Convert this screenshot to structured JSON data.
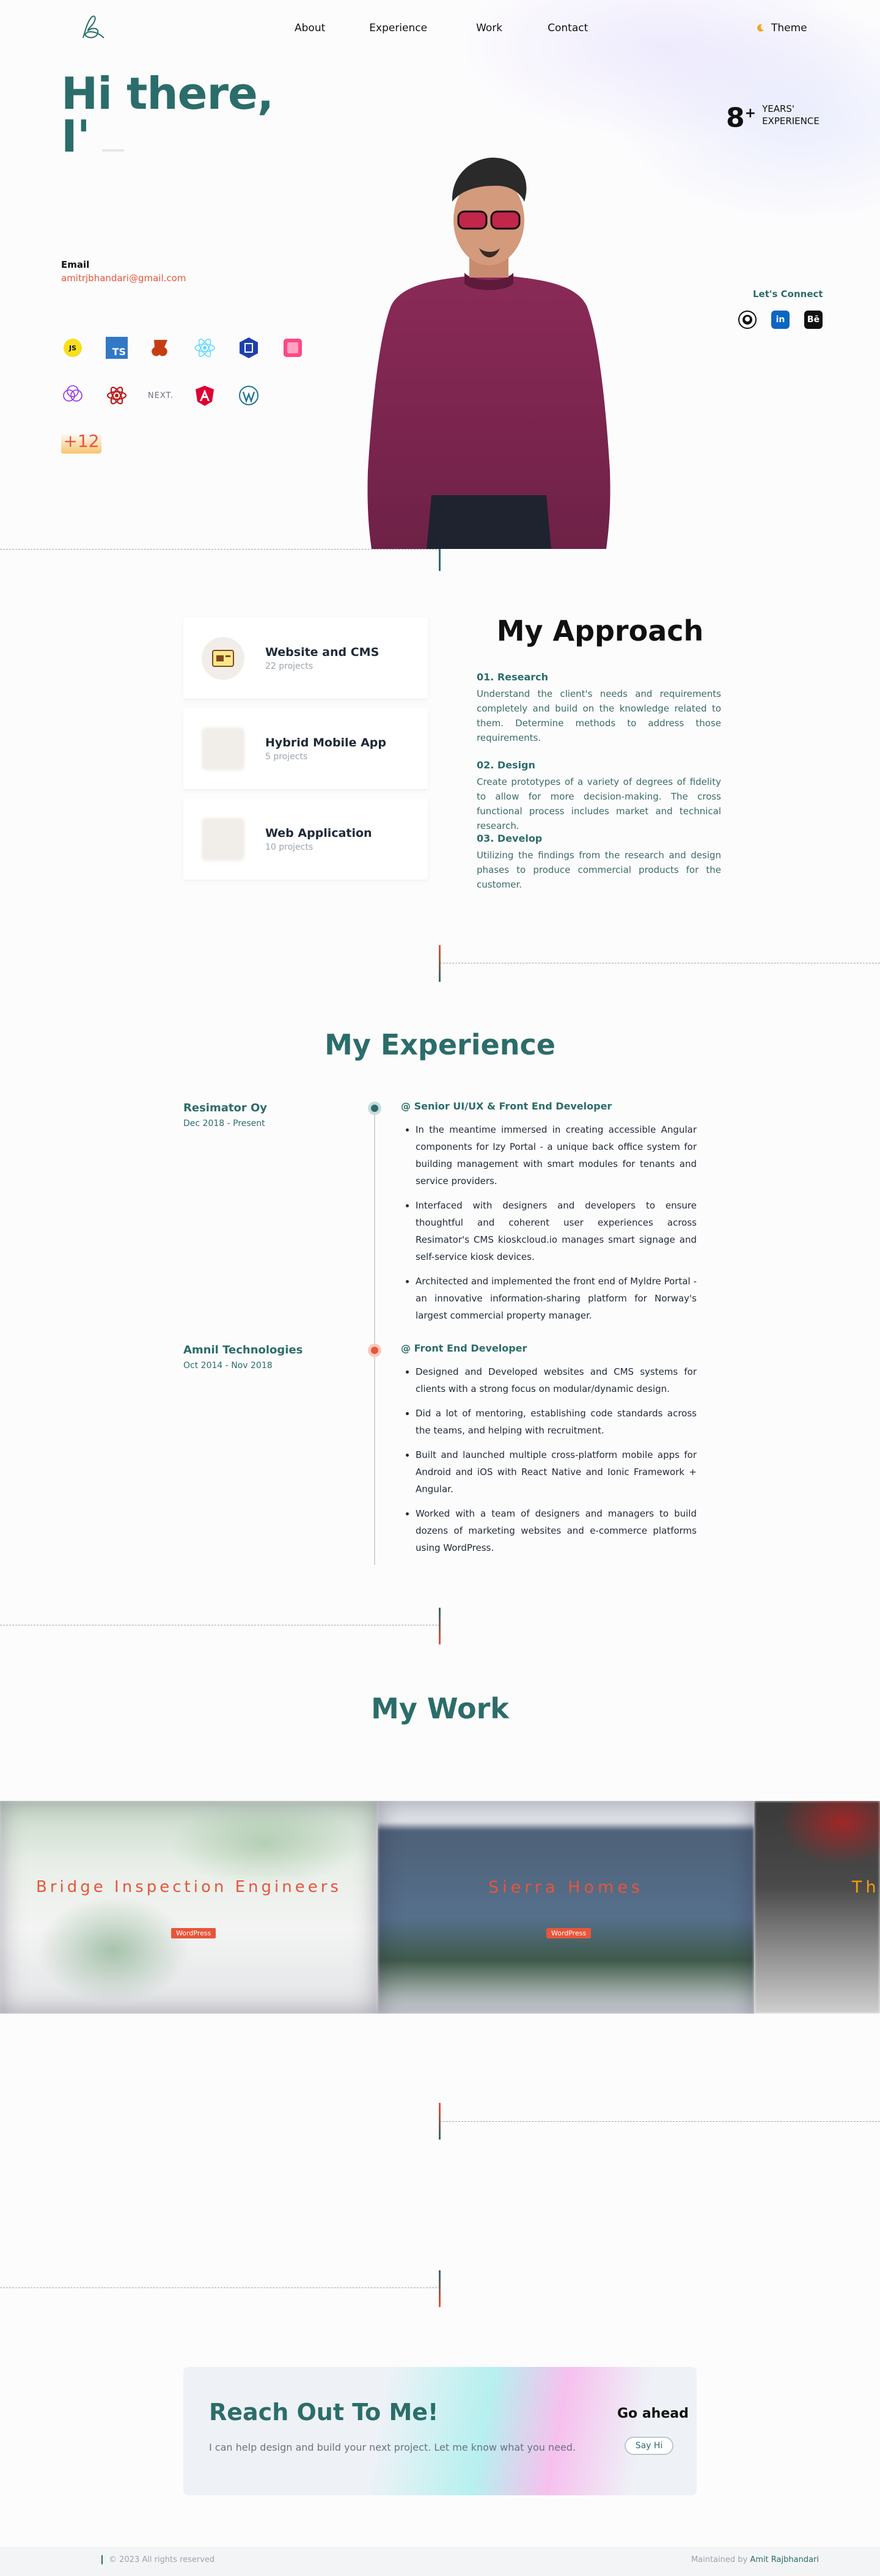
{
  "nav": {
    "links": [
      "About",
      "Experience",
      "Work",
      "Contact"
    ],
    "theme_label": "Theme"
  },
  "hero": {
    "title_line1": "Hi there,",
    "title_line2": "I'",
    "email_label": "Email",
    "email": "amitrjbhandari@gmail.com",
    "years_num": "8",
    "years_plus": "+",
    "years_label_1": "YEARS'",
    "years_label_2": "EXPERIENCE",
    "connect_label": "Let's Connect",
    "tech_more": "+12",
    "tech_next": "NEXT.",
    "tech_ts": "TS",
    "tech_js": "JS"
  },
  "approach": {
    "title": "My Approach",
    "cards": [
      {
        "title": "Website and CMS",
        "sub": "22 projects"
      },
      {
        "title": "Hybrid Mobile App",
        "sub": "5 projects"
      },
      {
        "title": "Web Application",
        "sub": "10 projects"
      }
    ],
    "steps": [
      {
        "title": "01. Research",
        "text": "Understand the client's needs and requirements completely and build on the knowledge related to them. Determine methods to address those requirements."
      },
      {
        "title": "02. Design",
        "text": "Create prototypes of a variety of degrees of fidelity to allow for more decision-making. The cross functional process includes market and technical research."
      },
      {
        "title": "03. Develop",
        "text": "Utilizing the findings from the research and design phases to produce commercial products for the customer."
      }
    ]
  },
  "experience": {
    "title": "My Experience",
    "jobs": [
      {
        "company": "Resimator Oy",
        "period": "Dec 2018 - Present",
        "role": "@ Senior UI/UX & Front End Developer",
        "bullets": [
          "In the meantime immersed in creating accessible Angular components for Izy Portal - a unique back office system for building management with smart modules for tenants and service providers.",
          "Interfaced with designers and developers to ensure thoughtful and coherent user experiences across Resimator's CMS kioskcloud.io manages smart signage and self-service kiosk devices.",
          "Architected and implemented the front end of Myldre Portal - an innovative information-sharing platform for Norway's largest commercial property manager."
        ]
      },
      {
        "company": "Amnil Technologies",
        "period": "Oct 2014 - Nov 2018",
        "role": "@ Front End Developer",
        "bullets": [
          "Designed and Developed websites and CMS systems for clients with a strong focus on modular/dynamic design.",
          "Did a lot of mentoring, establishing code standards across the teams, and helping with recruitment.",
          "Built and launched multiple cross-platform mobile apps for Android and iOS with React Native and Ionic Framework + Angular.",
          "Worked with a team of designers and managers to build dozens of marketing websites and e-commerce platforms using WordPress."
        ]
      }
    ]
  },
  "work": {
    "title": "My Work",
    "projects": [
      {
        "name": "Bridge Inspection Engineers",
        "tag": "WordPress"
      },
      {
        "name": "Sierra Homes",
        "tag": "WordPress"
      },
      {
        "name": "Th",
        "tag": ""
      }
    ]
  },
  "contact": {
    "title": "Reach Out To Me!",
    "text": "I can help design and build your next project. Let me know what you need.",
    "go_ahead": "Go ahead",
    "say_hi": "Say Hi"
  },
  "footer": {
    "left": "© 2023 All rights reserved",
    "right_prefix": "Maintained by ",
    "right_name": "Amit Rajbhandari"
  },
  "colors": {
    "primary": "#2b6d6a",
    "accent": "#e8553a"
  }
}
